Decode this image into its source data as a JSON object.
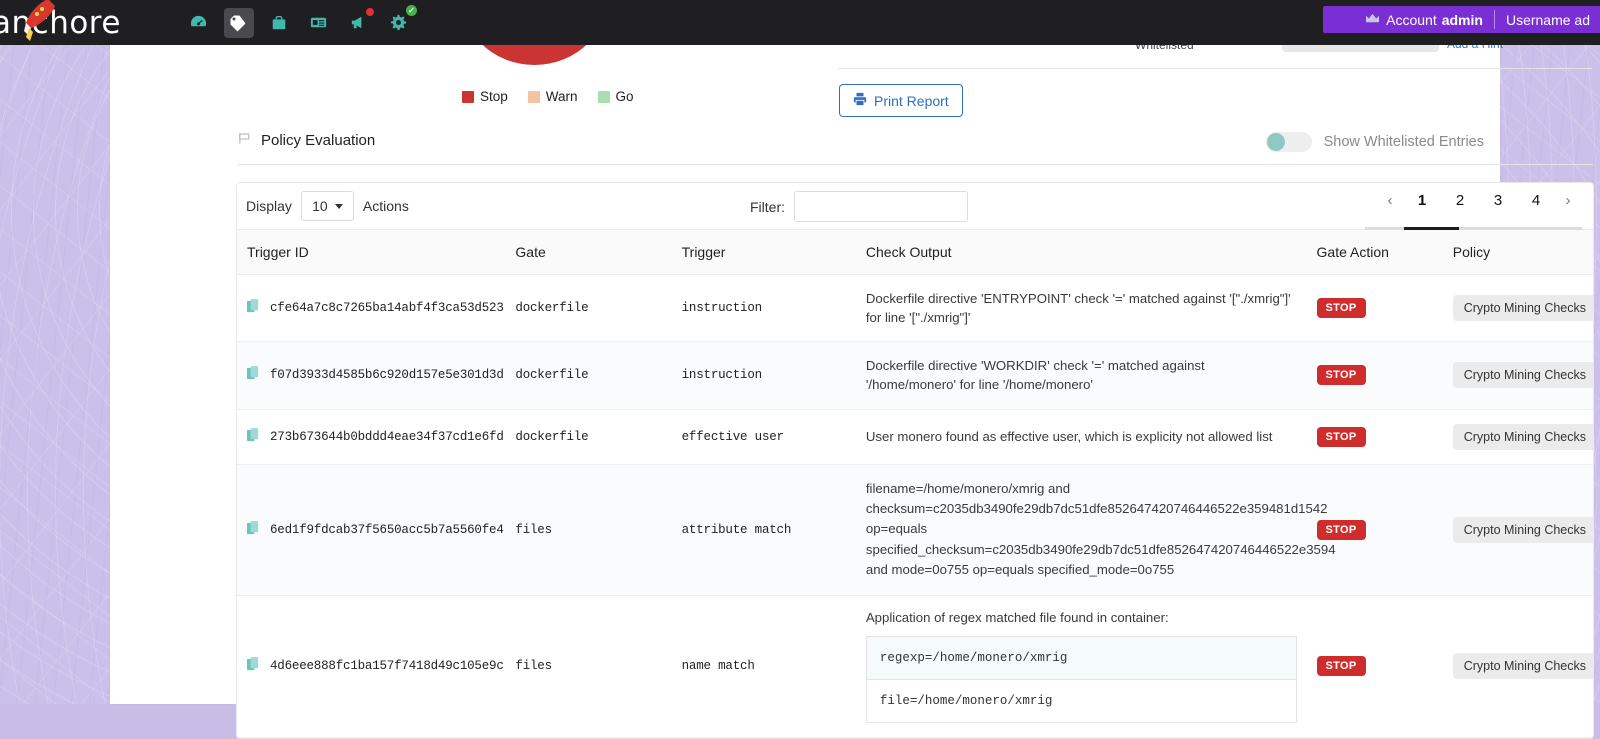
{
  "brand": "anchore",
  "nav": {
    "items": [
      {
        "name": "dashboard-icon",
        "label": "Dashboard",
        "active": false
      },
      {
        "name": "tags-icon",
        "label": "Images",
        "active": true
      },
      {
        "name": "briefcase-icon",
        "label": "Policy Bundles",
        "active": false
      },
      {
        "name": "reports-icon",
        "label": "Reports",
        "active": false
      },
      {
        "name": "alerts-megaphone-icon",
        "label": "Notifications",
        "active": false
      },
      {
        "name": "settings-gear-icon",
        "label": "System",
        "active": false
      }
    ]
  },
  "account": {
    "crown_icon": "crown-icon",
    "account_label": "Account",
    "account_value": "admin",
    "username_label": "Username ad"
  },
  "chart_data": {
    "type": "pie",
    "title": "",
    "categories": [
      "Stop",
      "Warn",
      "Go"
    ],
    "values": [
      100,
      0,
      0
    ],
    "colors": [
      "#cc3333",
      "#f5c3a4",
      "#a9dfb0"
    ],
    "legend_position": "bottom",
    "note": "Donut chart mostly cut off at top of viewport; only bottom arc visible"
  },
  "legend": [
    {
      "label": "Stop",
      "color": "#cc3333"
    },
    {
      "label": "Warn",
      "color": "#f5c3a4"
    },
    {
      "label": "Go",
      "color": "#a9dfb0"
    }
  ],
  "partial_top": {
    "left_text": "Whitelisted",
    "right_text": "Add a Hint"
  },
  "print_report": {
    "label": "Print Report",
    "icon": "printer-icon",
    "color": "#2f6fc0"
  },
  "policy_evaluation": {
    "icon": "flag-icon",
    "title": "Policy Evaluation",
    "toggle_label": "Show Whitelisted Entries",
    "toggle_on": false
  },
  "controls": {
    "display_label": "Display",
    "display_value": "10",
    "actions_label": "Actions",
    "filter_label": "Filter:",
    "filter_value": "",
    "filter_placeholder": ""
  },
  "pagination": {
    "prev": "‹",
    "next": "›",
    "pages": [
      "1",
      "2",
      "3",
      "4"
    ],
    "current": "1"
  },
  "table": {
    "headers": [
      "Trigger ID",
      "Gate",
      "Trigger",
      "Check Output",
      "Gate Action",
      "Policy"
    ],
    "rows": [
      {
        "trigger_id": "cfe64a7c8c7265ba14abf4f3ca53d523",
        "gate": "dockerfile",
        "trigger": "instruction",
        "check_output": "Dockerfile directive 'ENTRYPOINT' check '=' matched against '[\"./xmrig\"]' for line '[\"./xmrig\"]'",
        "gate_action": "STOP",
        "policy": "Crypto Mining Checks"
      },
      {
        "trigger_id": "f07d3933d4585b6c920d157e5e301d3d",
        "gate": "dockerfile",
        "trigger": "instruction",
        "check_output": "Dockerfile directive 'WORKDIR' check '=' matched against '/home/monero' for line '/home/monero'",
        "gate_action": "STOP",
        "policy": "Crypto Mining Checks"
      },
      {
        "trigger_id": "273b673644b0bddd4eae34f37cd1e6fd",
        "gate": "dockerfile",
        "trigger": "effective user",
        "check_output": "User monero found as effective user, which is explicity not allowed list",
        "gate_action": "STOP",
        "policy": "Crypto Mining Checks"
      },
      {
        "trigger_id": "6ed1f9fdcab37f5650acc5b7a5560fe4",
        "gate": "files",
        "trigger": "attribute match",
        "check_output_lines": [
          "filename=/home/monero/xmrig and",
          "checksum=c2035db3490fe29db7dc51dfe852647420746446522e359481d1542",
          "op=equals",
          "specified_checksum=c2035db3490fe29db7dc51dfe852647420746446522e3594",
          "and mode=0o755 op=equals specified_mode=0o755"
        ],
        "gate_action": "STOP",
        "policy": "Crypto Mining Checks"
      },
      {
        "trigger_id": "4d6eee888fc1ba157f7418d49c105e9c",
        "gate": "files",
        "trigger": "name match",
        "check_output_head": "Application of regex matched file found in container:",
        "check_output_box1": "regexp=/home/monero/xmrig",
        "check_output_box2": "file=/home/monero/xmrig",
        "gate_action": "STOP",
        "policy": "Crypto Mining Checks"
      }
    ]
  }
}
